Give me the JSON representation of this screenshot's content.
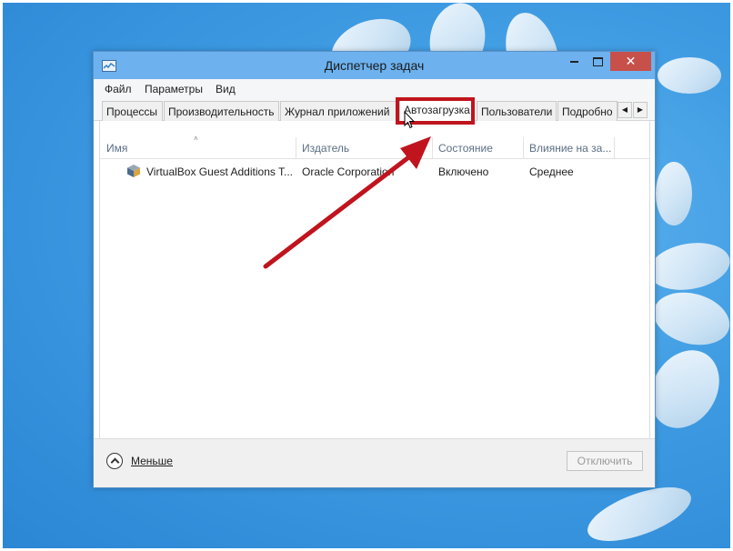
{
  "window": {
    "title": "Диспетчер задач",
    "close_label": "✕"
  },
  "menu": {
    "items": [
      "Файл",
      "Параметры",
      "Вид"
    ]
  },
  "tabs": [
    {
      "label": "Процессы",
      "active": false
    },
    {
      "label": "Производительность",
      "active": false
    },
    {
      "label": "Журнал приложений",
      "active": false
    },
    {
      "label": "Автозагрузка",
      "active": true
    },
    {
      "label": "Пользователи",
      "active": false
    },
    {
      "label": "Подробно",
      "active": false
    }
  ],
  "tab_scroll": {
    "left": "◀",
    "right": "▶"
  },
  "table": {
    "sort_indicator": "˄",
    "columns": [
      "Имя",
      "Издатель",
      "Состояние",
      "Влияние на за..."
    ],
    "rows": [
      {
        "name": "VirtualBox Guest Additions T...",
        "publisher": "Oracle Corporation",
        "status": "Включено",
        "impact": "Среднее"
      }
    ]
  },
  "footer": {
    "fewer_label": "Меньше",
    "disable_button": "Отключить"
  },
  "annotation": {
    "color": "#c0141e",
    "icons": [
      "cursor-icon",
      "annotation-arrow"
    ]
  },
  "colors": {
    "titlebar": "#6db2ef",
    "close_button": "#c7504a",
    "desktop": "#3e9be2"
  }
}
